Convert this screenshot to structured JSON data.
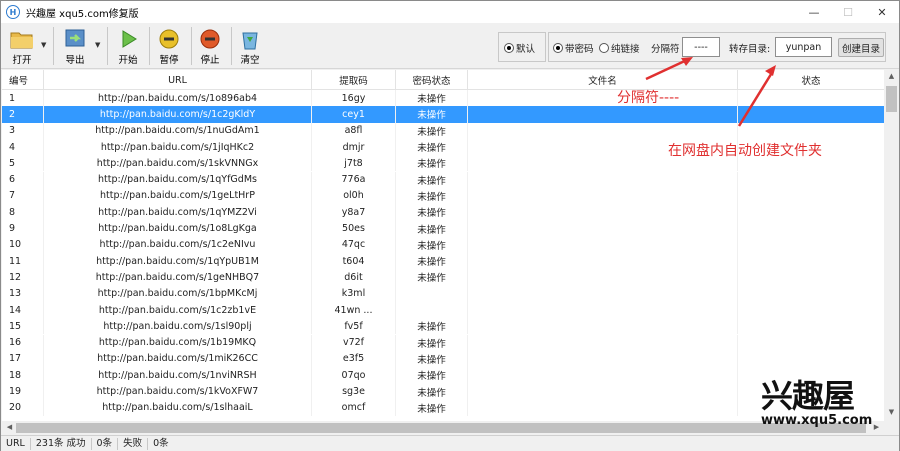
{
  "window": {
    "title": "兴趣屋 xqu5.com修复版"
  },
  "toolbar": {
    "open": "打开",
    "export": "导出",
    "start": "开始",
    "pause": "暂停",
    "stop": "停止",
    "clear": "清空"
  },
  "options": {
    "default_label": "默认",
    "with_password_label": "带密码",
    "pure_link_label": "纯链接",
    "separator_label": "分隔符",
    "separator_value": "----",
    "save_dir_label": "转存目录:",
    "save_dir_value": "yunpan",
    "mkdir_label": "创建目录"
  },
  "table": {
    "headers": [
      "编号",
      "URL",
      "提取码",
      "密码状态",
      "文件名",
      "状态"
    ],
    "rows": [
      [
        "1",
        "http://pan.baidu.com/s/1o896ab4",
        "16gy",
        "未操作"
      ],
      [
        "2",
        "http://pan.baidu.com/s/1c2gKldY",
        "cey1",
        "未操作"
      ],
      [
        "3",
        "http://pan.baidu.com/s/1nuGdAm1",
        "a8fl",
        "未操作"
      ],
      [
        "4",
        "http://pan.baidu.com/s/1jIqHKc2",
        "dmjr",
        "未操作"
      ],
      [
        "5",
        "http://pan.baidu.com/s/1skVNNGx",
        "j7t8",
        "未操作"
      ],
      [
        "6",
        "http://pan.baidu.com/s/1qYfGdMs",
        "776a",
        "未操作"
      ],
      [
        "7",
        "http://pan.baidu.com/s/1geLtHrP",
        "ol0h",
        "未操作"
      ],
      [
        "8",
        "http://pan.baidu.com/s/1qYMZ2Vi",
        "y8a7",
        "未操作"
      ],
      [
        "9",
        "http://pan.baidu.com/s/1o8LgKga",
        "50es",
        "未操作"
      ],
      [
        "10",
        "http://pan.baidu.com/s/1c2eNIvu",
        "47qc",
        "未操作"
      ],
      [
        "11",
        "http://pan.baidu.com/s/1qYpUB1M",
        "t604",
        "未操作"
      ],
      [
        "12",
        "http://pan.baidu.com/s/1geNHBQ7",
        "d6it",
        "未操作"
      ],
      [
        "13",
        "http://pan.baidu.com/s/1bpMKcMj",
        "k3ml",
        ""
      ],
      [
        "14",
        "http://pan.baidu.com/s/1c2zb1vE",
        "41wn        ...",
        ""
      ],
      [
        "15",
        "http://pan.baidu.com/s/1sl90plj",
        "fv5f",
        "未操作"
      ],
      [
        "16",
        "http://pan.baidu.com/s/1b19MKQ",
        "v72f",
        "未操作"
      ],
      [
        "17",
        "http://pan.baidu.com/s/1miK26CC",
        "e3f5",
        "未操作"
      ],
      [
        "18",
        "http://pan.baidu.com/s/1nviNRSH",
        "07qo",
        "未操作"
      ],
      [
        "19",
        "http://pan.baidu.com/s/1kVoXFW7",
        "sg3e",
        "未操作"
      ],
      [
        "20",
        "http://pan.baidu.com/s/1slhaaiL",
        "omcf",
        "未操作"
      ]
    ],
    "selected_row": 1
  },
  "annotations": {
    "separator_note": "分隔符----",
    "folder_note": "在网盘内自动创建文件夹"
  },
  "statusbar": {
    "url": "URL",
    "count": "231条 成功",
    "success": "0条",
    "fail_label": "失败",
    "fail": "0条"
  },
  "watermark": {
    "brand": "兴趣屋",
    "url": "www.xqu5.com"
  },
  "colors": {
    "selection": "#3399ff",
    "annotation": "#e03030"
  }
}
